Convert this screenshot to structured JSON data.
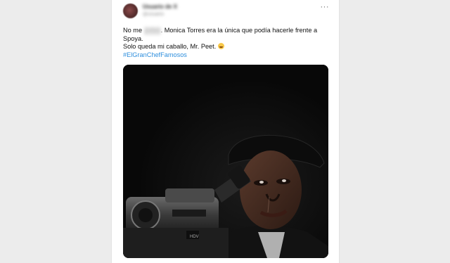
{
  "tweet": {
    "author_name": "Usuario de X",
    "author_handle": "@usuario",
    "more_label": "···",
    "text_line1_prefix": "No me",
    "text_line1_redacted": "jodas",
    "text_line1_suffix": ". Monica Torres era la única que podía hacerle frente a",
    "text_line2": "Spoya.",
    "text_line3_main": "Solo queda mi caballo, Mr. Peet.",
    "hashtag": "#ElGranChefFamosos",
    "media_alt": "meme-image"
  },
  "colors": {
    "hashtag": "#2f8fdd",
    "text": "#111111",
    "background": "#ececec",
    "card": "#ffffff"
  }
}
